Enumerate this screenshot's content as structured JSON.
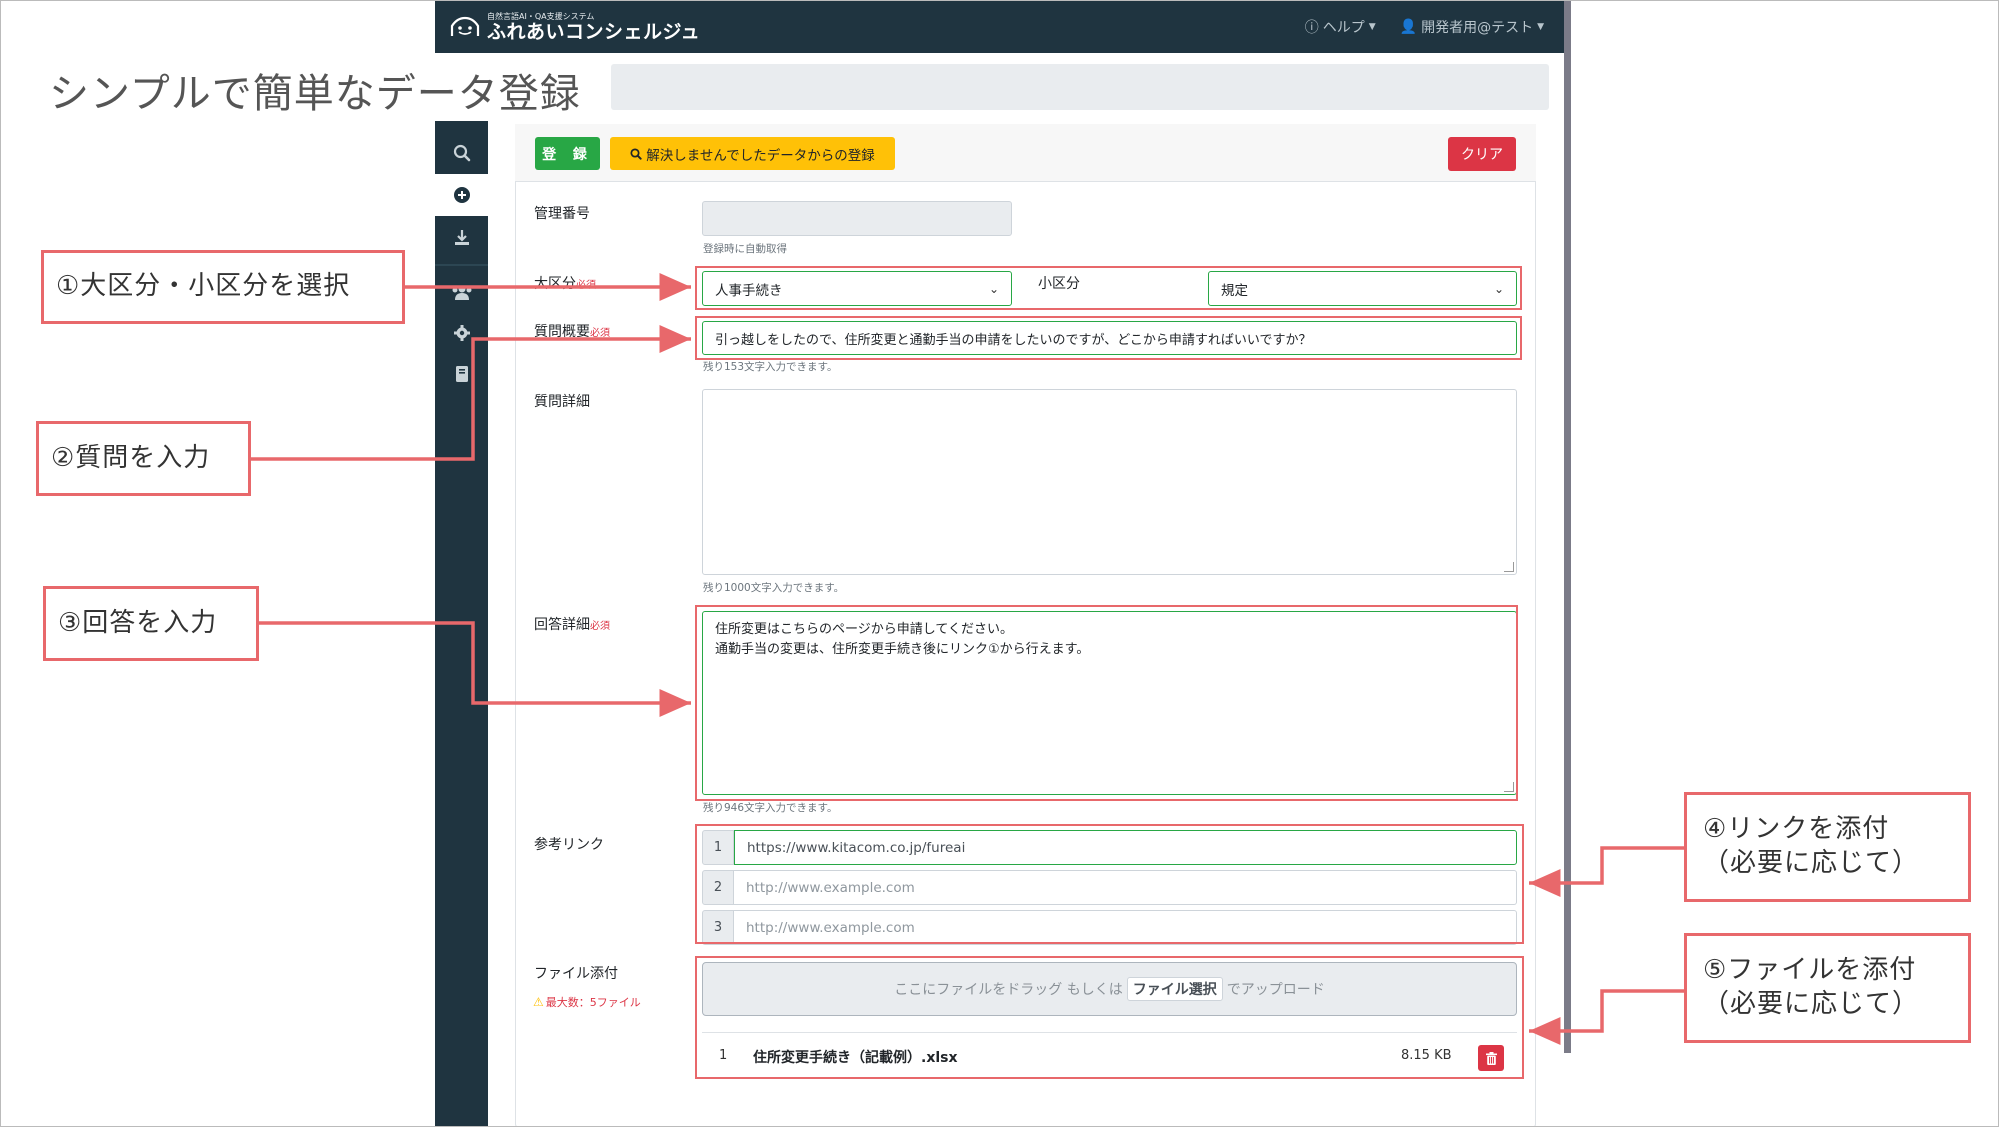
{
  "slide_title": "シンプルで簡単なデータ登録",
  "navbar": {
    "logo_sub": "自然言語AI・QA支援システム",
    "logo_main": "ふれあいコンシェルジュ",
    "help_label": "ヘルプ",
    "user_label": "開発者用@テスト"
  },
  "sidebar": {
    "items": [
      {
        "icon": "search-icon",
        "active": false
      },
      {
        "icon": "plus-circle-icon",
        "active": true
      },
      {
        "icon": "download-icon",
        "active": false
      },
      {
        "icon": "users-icon",
        "active": false
      },
      {
        "icon": "gear-icon",
        "active": false
      },
      {
        "icon": "book-icon",
        "active": false
      }
    ]
  },
  "toolbar": {
    "register_label": "登 録",
    "unresolved_label": "解決しませんでしたデータからの登録",
    "clear_label": "クリア"
  },
  "form": {
    "management_no": {
      "label": "管理番号",
      "value": "",
      "help": "登録時に自動取得"
    },
    "category": {
      "label": "大区分",
      "required": "必須",
      "value": "人事手続き"
    },
    "subcategory": {
      "label": "小区分",
      "value": "規定"
    },
    "question_summary": {
      "label": "質問概要",
      "required": "必須",
      "value": "引っ越しをしたので、住所変更と通勤手当の申請をしたいのですが、どこから申請すればいいですか？",
      "help": "残り153文字入力できます。"
    },
    "question_detail": {
      "label": "質問詳細",
      "value": "",
      "help": "残り1000文字入力できます。"
    },
    "answer_detail": {
      "label": "回答詳細",
      "required": "必須",
      "line1": "住所変更はこちらのページから申請してください。",
      "line2": "通勤手当の変更は、住所変更手続き後にリンク①から行えます。",
      "help": "残り946文字入力できます。"
    },
    "reference_links": {
      "label": "参考リンク",
      "rows": [
        {
          "num": "1",
          "value": "https://www.kitacom.co.jp/fureai"
        },
        {
          "num": "2",
          "placeholder": "http://www.example.com"
        },
        {
          "num": "3",
          "placeholder": "http://www.example.com"
        }
      ]
    },
    "attachments": {
      "label": "ファイル添付",
      "max_note": "最大数：5ファイル",
      "drop_before": "ここにファイルをドラッグ もしくは",
      "drop_button": "ファイル選択",
      "drop_after": "でアップロード",
      "files": [
        {
          "num": "1",
          "name": "住所変更手続き（記載例）.xlsx",
          "size": "8.15 KB"
        }
      ]
    }
  },
  "callouts": {
    "c1": "①大区分・小区分を選択",
    "c2": "②質問を入力",
    "c3": "③回答を入力",
    "c4_line1": "④リンクを添付",
    "c4_line2": "（必要に応じて）",
    "c5_line1": "⑤ファイルを添付",
    "c5_line2": "（必要に応じて）"
  },
  "colors": {
    "navbar": "#1f3440",
    "register": "#28a745",
    "unresolved": "#ffc107",
    "clear": "#dc3545",
    "callout_border": "#e8686b"
  }
}
